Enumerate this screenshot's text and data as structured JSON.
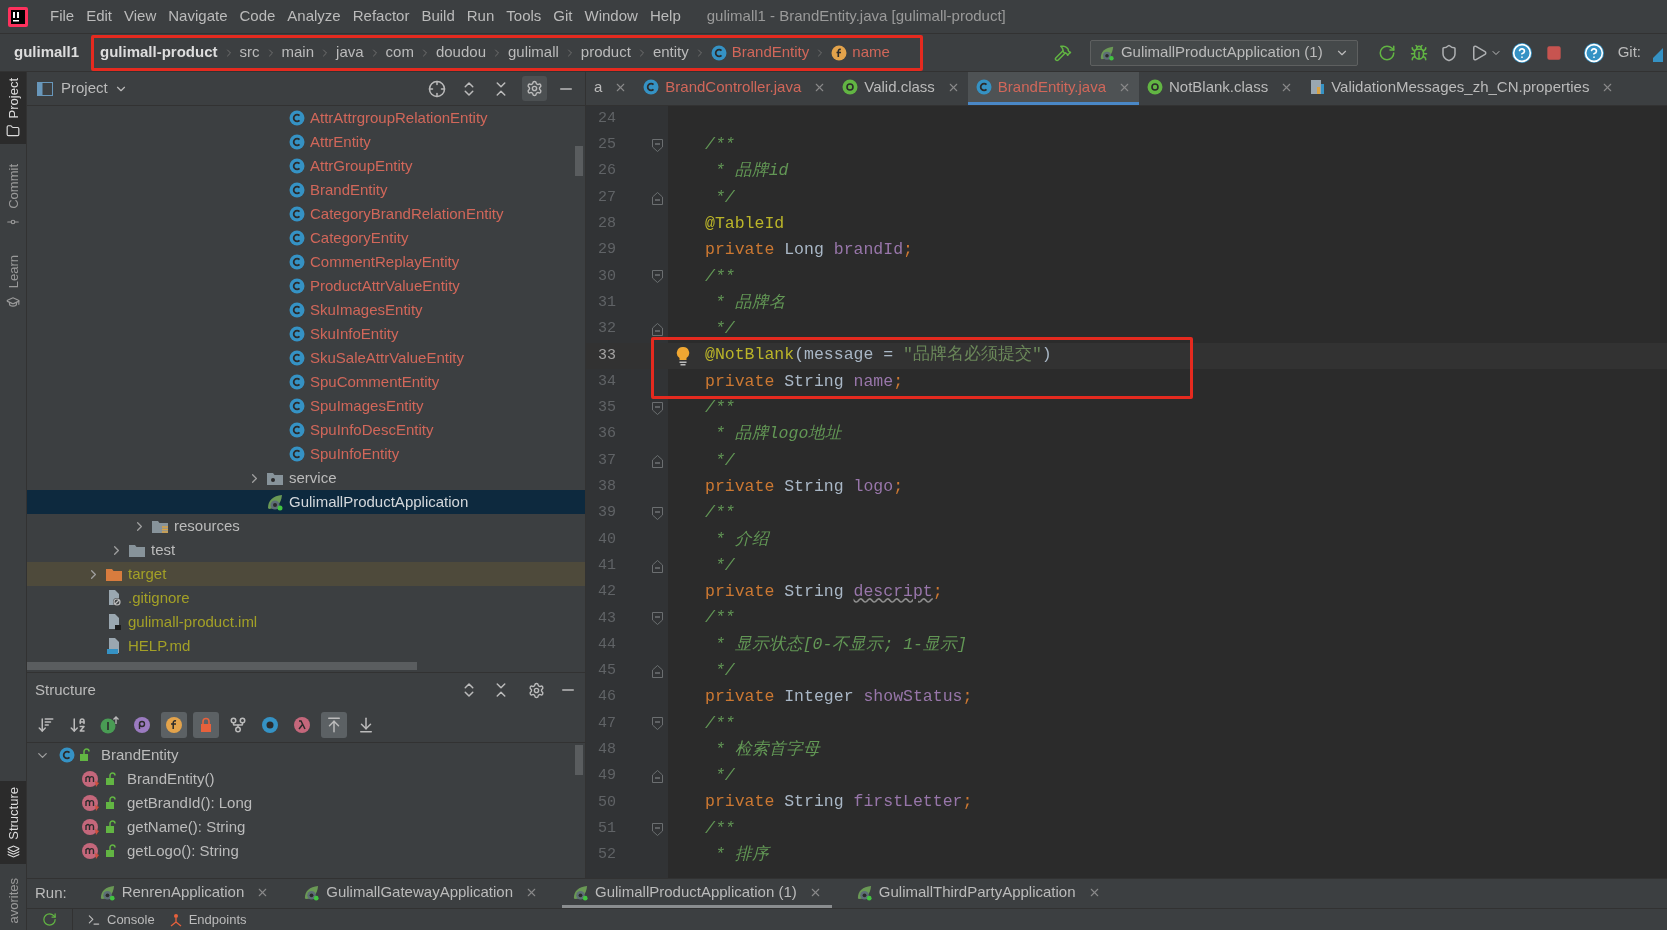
{
  "menu_bar": {
    "items": [
      "File",
      "Edit",
      "View",
      "Navigate",
      "Code",
      "Analyze",
      "Refactor",
      "Build",
      "Run",
      "Tools",
      "Git",
      "Window",
      "Help"
    ],
    "title": "gulimall1 - BrandEntity.java [gulimall-product]"
  },
  "nav_bar": {
    "project": "gulimall1",
    "breadcrumb_highlighted": true,
    "breadcrumb": [
      {
        "label": "gulimall-product",
        "kind": "module",
        "color": "#dddddd"
      },
      {
        "label": "src",
        "kind": "folder",
        "color": "#bbbbbb"
      },
      {
        "label": "main",
        "kind": "folder",
        "color": "#bbbbbb"
      },
      {
        "label": "java",
        "kind": "folder",
        "color": "#bbbbbb"
      },
      {
        "label": "com",
        "kind": "folder",
        "color": "#bbbbbb"
      },
      {
        "label": "doudou",
        "kind": "folder",
        "color": "#bbbbbb"
      },
      {
        "label": "gulimall",
        "kind": "folder",
        "color": "#bbbbbb"
      },
      {
        "label": "product",
        "kind": "folder",
        "color": "#bbbbbb"
      },
      {
        "label": "entity",
        "kind": "folder",
        "color": "#bbbbbb"
      },
      {
        "label": "BrandEntity",
        "kind": "class",
        "color": "#d1675a"
      },
      {
        "label": "name",
        "kind": "field",
        "color": "#d1675a"
      }
    ],
    "run_config": "GulimallProductApplication (1)",
    "git_label": "Git:"
  },
  "side_strip": {
    "top": [
      {
        "label": "Project",
        "selected": true
      },
      {
        "label": "Commit",
        "selected": false
      },
      {
        "label": "Learn",
        "selected": false
      }
    ],
    "bottom": [
      {
        "label": "Structure",
        "selected": true
      },
      {
        "label": "avorites",
        "selected": false
      }
    ]
  },
  "project_panel": {
    "title": "Project",
    "tree": [
      {
        "children": [
          {
            "children": [
              {
                "children": [
                  {
                    "children": [
                      {
                        "children": [
                          {
                            "children": [
                              {
                                "children": [
                                  {
                                    "children": [
                                      {
                                        "label": "AttrAttrgroupRelationEntity",
                                        "kind": "class",
                                        "color": "#d1675a",
                                        "selected": false
                                      },
                                      {
                                        "label": "AttrEntity",
                                        "kind": "class",
                                        "color": "#d1675a",
                                        "selected": false
                                      },
                                      {
                                        "label": "AttrGroupEntity",
                                        "kind": "class",
                                        "color": "#d1675a",
                                        "selected": false
                                      },
                                      {
                                        "label": "BrandEntity",
                                        "kind": "class",
                                        "color": "#d1675a",
                                        "selected": false
                                      },
                                      {
                                        "label": "CategoryBrandRelationEntity",
                                        "kind": "class",
                                        "color": "#d1675a",
                                        "selected": false
                                      },
                                      {
                                        "label": "CategoryEntity",
                                        "kind": "class",
                                        "color": "#d1675a",
                                        "selected": false
                                      },
                                      {
                                        "label": "CommentReplayEntity",
                                        "kind": "class",
                                        "color": "#d1675a",
                                        "selected": false
                                      },
                                      {
                                        "label": "ProductAttrValueEntity",
                                        "kind": "class",
                                        "color": "#d1675a",
                                        "selected": false
                                      },
                                      {
                                        "label": "SkuImagesEntity",
                                        "kind": "class",
                                        "color": "#d1675a",
                                        "selected": false
                                      },
                                      {
                                        "label": "SkuInfoEntity",
                                        "kind": "class",
                                        "color": "#d1675a",
                                        "selected": false
                                      },
                                      {
                                        "label": "SkuSaleAttrValueEntity",
                                        "kind": "class",
                                        "color": "#d1675a",
                                        "selected": false
                                      },
                                      {
                                        "label": "SpuCommentEntity",
                                        "kind": "class",
                                        "color": "#d1675a",
                                        "selected": false
                                      },
                                      {
                                        "label": "SpuImagesEntity",
                                        "kind": "class",
                                        "color": "#d1675a",
                                        "selected": false
                                      },
                                      {
                                        "label": "SpuInfoDescEntity",
                                        "kind": "class",
                                        "color": "#d1675a",
                                        "selected": false
                                      },
                                      {
                                        "label": "SpuInfoEntity",
                                        "kind": "class",
                                        "color": "#d1675a",
                                        "selected": false
                                      }
                                    ]
                                  },
                                  {
                                    "label": "service",
                                    "kind": "package",
                                    "expanded": false,
                                    "color": "#bbbbbb",
                                    "selected": false
                                  },
                                  {
                                    "label": "GulimallProductApplication",
                                    "kind": "spring_app",
                                    "selected": true
                                  }
                                ]
                              }
                            ]
                          }
                        ]
                      }
                    ]
                  }
                ]
              },
              {
                "label": "resources",
                "kind": "resources_folder",
                "expanded": false,
                "color": "#bbbbbb",
                "selected": false
              }
            ]
          },
          {
            "label": "test",
            "kind": "folder",
            "expanded": false,
            "color": "#bbbbbb",
            "selected": false
          }
        ]
      },
      {
        "label": "target",
        "kind": "excluded_folder",
        "expanded": false,
        "excluded": true,
        "color": "#a3a027",
        "selected": false
      },
      {
        "label": ".gitignore",
        "kind": "ignore_file",
        "color": "#a3a027",
        "selected": false
      },
      {
        "label": "gulimall-product.iml",
        "kind": "module_file",
        "color": "#a3a027",
        "selected": false
      },
      {
        "label": "HELP.md",
        "kind": "markdown_file",
        "color": "#a3a027",
        "selected": false
      }
    ]
  },
  "structure_panel": {
    "title": "Structure",
    "toolbar": [
      {
        "kind": "sort_visibility",
        "on": false
      },
      {
        "kind": "sort_alpha",
        "on": false
      },
      {
        "kind": "inherited",
        "on": false
      },
      {
        "kind": "properties",
        "on": false
      },
      {
        "kind": "fields",
        "on": true
      },
      {
        "kind": "non_public",
        "on": true
      },
      {
        "kind": "fork",
        "on": false
      },
      {
        "kind": "anonymous",
        "on": false
      },
      {
        "kind": "lambdas",
        "on": false
      },
      {
        "kind": "scroll_to",
        "on": true
      },
      {
        "kind": "scroll_from",
        "on": false
      }
    ],
    "tree": [
      {
        "label": "BrandEntity",
        "kind": "class",
        "expanded": true,
        "children": [
          {
            "label": "BrandEntity()",
            "kind": "method"
          },
          {
            "label": "getBrandId(): Long",
            "kind": "method"
          },
          {
            "label": "getName(): String",
            "kind": "method"
          },
          {
            "label": "getLogo(): String",
            "kind": "method"
          }
        ]
      }
    ]
  },
  "editor": {
    "tabs": [
      {
        "label": "a",
        "kind": "none",
        "color": "#bbbbbb",
        "selected": false
      },
      {
        "label": "BrandController.java",
        "kind": "class",
        "color": "#d1675a",
        "selected": false
      },
      {
        "label": "Valid.class",
        "kind": "annotation",
        "color": "#bbbbbb",
        "selected": false
      },
      {
        "label": "BrandEntity.java",
        "kind": "class",
        "color": "#d1675a",
        "selected": true
      },
      {
        "label": "NotBlank.class",
        "kind": "annotation",
        "color": "#bbbbbb",
        "selected": false
      },
      {
        "label": "ValidationMessages_zh_CN.properties",
        "kind": "properties",
        "color": "#bbbbbb",
        "selected": false
      }
    ],
    "lines": [
      {
        "number": "24"
      },
      {
        "number": "25",
        "fold_start": true,
        "tokens": [
          {
            "kind": "comment",
            "text": "/**"
          }
        ]
      },
      {
        "number": "26",
        "tokens": [
          {
            "kind": "comment_body",
            "text": "* 品牌id"
          }
        ]
      },
      {
        "number": "27",
        "fold_end": true,
        "tokens": [
          {
            "kind": "comment_body",
            "text": "*/"
          }
        ]
      },
      {
        "number": "28",
        "tokens": [
          {
            "kind": "annotation",
            "text": "@TableId"
          }
        ]
      },
      {
        "number": "29",
        "tokens": [
          {
            "kind": "keyword",
            "text": "private "
          },
          {
            "kind": "type",
            "text": "Long "
          },
          {
            "kind": "field",
            "text": "brandId"
          },
          {
            "kind": "keyword",
            "text": ";"
          }
        ]
      },
      {
        "number": "30",
        "fold_start": true,
        "tokens": [
          {
            "kind": "comment",
            "text": "/**"
          }
        ]
      },
      {
        "number": "31",
        "tokens": [
          {
            "kind": "comment_body",
            "text": "* 品牌名"
          }
        ]
      },
      {
        "number": "32",
        "fold_end": true,
        "tokens": [
          {
            "kind": "comment_body",
            "text": "*/"
          }
        ]
      },
      {
        "number": "33",
        "current": true,
        "boxed": true,
        "tokens": [
          {
            "kind": "annotation",
            "text": "@NotBlank"
          },
          {
            "kind": "plain",
            "text": "(message = "
          },
          {
            "kind": "string",
            "text": "\"品牌名必须提交\""
          },
          {
            "kind": "plain",
            "text": ")"
          }
        ]
      },
      {
        "number": "34",
        "boxed": true,
        "tokens": [
          {
            "kind": "keyword",
            "text": "private "
          },
          {
            "kind": "type",
            "text": "String "
          },
          {
            "kind": "field",
            "text": "name"
          },
          {
            "kind": "keyword",
            "text": ";"
          }
        ]
      },
      {
        "number": "35",
        "fold_start": true,
        "tokens": [
          {
            "kind": "comment",
            "text": "/**"
          }
        ]
      },
      {
        "number": "36",
        "tokens": [
          {
            "kind": "comment_body",
            "text": "* 品牌logo地址"
          }
        ]
      },
      {
        "number": "37",
        "fold_end": true,
        "tokens": [
          {
            "kind": "comment_body",
            "text": "*/"
          }
        ]
      },
      {
        "number": "38",
        "tokens": [
          {
            "kind": "keyword",
            "text": "private "
          },
          {
            "kind": "type",
            "text": "String "
          },
          {
            "kind": "field",
            "text": "logo"
          },
          {
            "kind": "keyword",
            "text": ";"
          }
        ]
      },
      {
        "number": "39",
        "fold_start": true,
        "tokens": [
          {
            "kind": "comment",
            "text": "/**"
          }
        ]
      },
      {
        "number": "40",
        "tokens": [
          {
            "kind": "comment_body",
            "text": "* 介绍"
          }
        ]
      },
      {
        "number": "41",
        "fold_end": true,
        "tokens": [
          {
            "kind": "comment_body",
            "text": "*/"
          }
        ]
      },
      {
        "number": "42",
        "tokens": [
          {
            "kind": "keyword",
            "text": "private "
          },
          {
            "kind": "type",
            "text": "String "
          },
          {
            "kind": "field",
            "text": "descript",
            "typo": true
          },
          {
            "kind": "keyword",
            "text": ";"
          }
        ]
      },
      {
        "number": "43",
        "fold_start": true,
        "tokens": [
          {
            "kind": "comment",
            "text": "/**"
          }
        ]
      },
      {
        "number": "44",
        "tokens": [
          {
            "kind": "comment_body",
            "text": "* 显示状态[0-不显示; 1-显示]"
          }
        ]
      },
      {
        "number": "45",
        "fold_end": true,
        "tokens": [
          {
            "kind": "comment_body",
            "text": "*/"
          }
        ]
      },
      {
        "number": "46",
        "tokens": [
          {
            "kind": "keyword",
            "text": "private "
          },
          {
            "kind": "type",
            "text": "Integer "
          },
          {
            "kind": "field",
            "text": "showStatus"
          },
          {
            "kind": "keyword",
            "text": ";"
          }
        ]
      },
      {
        "number": "47",
        "fold_start": true,
        "tokens": [
          {
            "kind": "comment",
            "text": "/**"
          }
        ]
      },
      {
        "number": "48",
        "tokens": [
          {
            "kind": "comment_body",
            "text": "* 检索首字母"
          }
        ]
      },
      {
        "number": "49",
        "fold_end": true,
        "tokens": [
          {
            "kind": "comment_body",
            "text": "*/"
          }
        ]
      },
      {
        "number": "50",
        "tokens": [
          {
            "kind": "keyword",
            "text": "private "
          },
          {
            "kind": "type",
            "text": "String "
          },
          {
            "kind": "field",
            "text": "firstLetter"
          },
          {
            "kind": "keyword",
            "text": ";"
          }
        ]
      },
      {
        "number": "51",
        "fold_start": true,
        "tokens": [
          {
            "kind": "comment",
            "text": "/**"
          }
        ]
      },
      {
        "number": "52",
        "tokens": [
          {
            "kind": "comment_body",
            "text": "* 排序"
          }
        ]
      }
    ]
  },
  "run_bar": {
    "label": "Run:",
    "tabs": [
      {
        "label": "RenrenApplication",
        "selected": false
      },
      {
        "label": "GulimallGatewayApplication",
        "selected": false
      },
      {
        "label": "GulimallProductApplication (1)",
        "selected": true
      },
      {
        "label": "GulimallThirdPartyApplication",
        "selected": false
      }
    ]
  },
  "console_bar": {
    "tabs": [
      {
        "label": "Console",
        "kind": "console"
      },
      {
        "label": "Endpoints",
        "kind": "endpoints"
      }
    ]
  }
}
